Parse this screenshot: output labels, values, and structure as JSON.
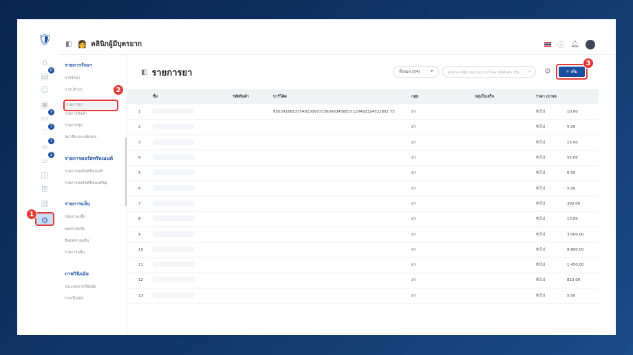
{
  "header": {
    "clinic_name": "คลินิกผู้มีบุตรยาก"
  },
  "rail": {
    "badges": [
      "0",
      "3",
      "7",
      "1",
      "2"
    ]
  },
  "submenu": [
    {
      "heading": "รายการรักษา",
      "items": [
        "การรักษา",
        "การบริการ",
        "รายการยา",
        "รายการสินค้า",
        "รายการชุด",
        "สมาชิกและแพ็คเกจ"
      ]
    },
    {
      "heading": "รายการคอร์สทรีทเมนท์",
      "items": [
        "รายการคอร์สทรีทเมนท์",
        "รายการคอร์สทรีทเมนท์ชุด"
      ]
    },
    {
      "heading": "รายการแล็บ",
      "items": [
        "กลุ่มงานแล็บ",
        "ผลตรวจแล็บ",
        "สิ่งส่งตรวจแล็บ",
        "รายการแล็บ"
      ]
    },
    {
      "heading": "ภาพวินิจฉัย",
      "items": [
        "ประเภทภาพวินิจฉัย",
        "ภาพวินิจฉัย"
      ]
    }
  ],
  "page": {
    "title": "รายการยา",
    "filter": "ทั้งหมด (54)",
    "search_placeholder": "ค้นหาจากชื่อรายการยา บาร์โค้ด รหัสสินค้า หรือ",
    "add_label": "+ เพิ่ม"
  },
  "annotations": [
    "1",
    "2",
    "3"
  ],
  "table": {
    "headers": [
      "",
      "ชื่อ",
      "รหัสสินค้า",
      "บาร์โค้ด",
      "กลุ่ม",
      "กลุ่มใบเสร็จ",
      "ราคา (บาท)"
    ],
    "rows": [
      {
        "n": "1",
        "barcode": "950391681375482309737360963458817129482324722892 75",
        "group": "ยา",
        "type": "ทั่วไป",
        "price": "10.00"
      },
      {
        "n": "2",
        "barcode": "",
        "group": "ยา",
        "type": "ทั่วไป",
        "price": "5.00"
      },
      {
        "n": "3",
        "barcode": "",
        "group": "ยา",
        "type": "ทั่วไป",
        "price": "15.00"
      },
      {
        "n": "4",
        "barcode": "",
        "group": "ยา",
        "type": "ทั่วไป",
        "price": "55.00"
      },
      {
        "n": "5",
        "barcode": "",
        "group": "ยา",
        "type": "ทั่วไป",
        "price": "6.00"
      },
      {
        "n": "6",
        "barcode": "",
        "group": "ยา",
        "type": "ทั่วไป",
        "price": "5.00"
      },
      {
        "n": "7",
        "barcode": "",
        "group": "ยา",
        "type": "ทั่วไป",
        "price": "300.00"
      },
      {
        "n": "8",
        "barcode": "",
        "group": "ยา",
        "type": "ทั่วไป",
        "price": "10.00"
      },
      {
        "n": "9",
        "barcode": "",
        "group": "ยา",
        "type": "ทั่วไป",
        "price": "3,000.00"
      },
      {
        "n": "10",
        "barcode": "",
        "group": "ยา",
        "type": "ทั่วไป",
        "price": "8,800.00"
      },
      {
        "n": "11",
        "barcode": "",
        "group": "ยา",
        "type": "ทั่วไป",
        "price": "1,450.00"
      },
      {
        "n": "12",
        "barcode": "",
        "group": "ยา",
        "type": "ทั่วไป",
        "price": "810.00"
      },
      {
        "n": "13",
        "barcode": "",
        "group": "ยา",
        "type": "ทั่วไป",
        "price": "5.00"
      }
    ]
  }
}
